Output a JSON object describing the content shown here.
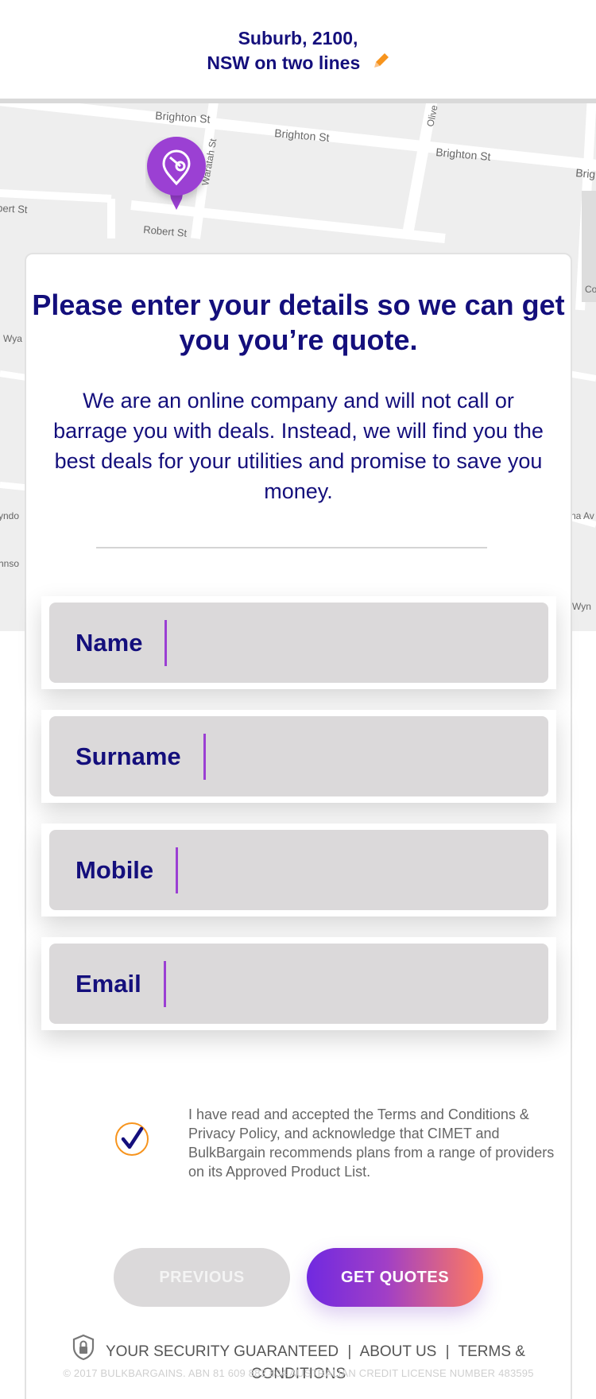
{
  "header": {
    "location_line1": "Suburb, 2100,",
    "location_line2": "NSW on two lines",
    "edit_icon": "pencil-icon"
  },
  "map": {
    "streets": [
      "Brighton St",
      "Brighton St",
      "Brighton St",
      "Brig",
      "Robert St",
      "bert St",
      "Waratah St",
      "Olive",
      "Wya",
      "yndo",
      "hnso",
      "Co",
      "na Av",
      "Wyn"
    ],
    "marker_icon": "location-pin-icon"
  },
  "card": {
    "title": "Please enter your details so we can get you you’re quote.",
    "intro": "We are an online company and will not call or barrage you with deals. Instead, we will find you the best deals for your utilities and promise to save you money."
  },
  "form": {
    "fields": [
      {
        "label": "Name",
        "value": ""
      },
      {
        "label": "Surname",
        "value": ""
      },
      {
        "label": "Mobile",
        "value": ""
      },
      {
        "label": "Email",
        "value": ""
      }
    ],
    "terms_checked": true,
    "terms_text": "I have read and accepted the Terms and Conditions & Privacy Policy, and acknowledge that CIMET and BulkBargain recommends plans from a range of providers on its Approved Product List."
  },
  "buttons": {
    "previous": "PREVIOUS",
    "get_quotes": "GET QUOTES"
  },
  "footer": {
    "security": "YOUR SECURITY GUARANTEED",
    "about": "ABOUT US",
    "terms": "TERMS & CONDITIONS",
    "separator": "|",
    "copyright": "© 2017 BULKBARGAINS. ABN 81 609 882 804 AUSTRALIAN CREDIT LICENSE NUMBER 483595"
  },
  "colors": {
    "brand_navy": "#140f7c",
    "accent_purple": "#9b3fd3",
    "accent_orange": "#f7941d",
    "field_bg": "#dbd9da"
  }
}
